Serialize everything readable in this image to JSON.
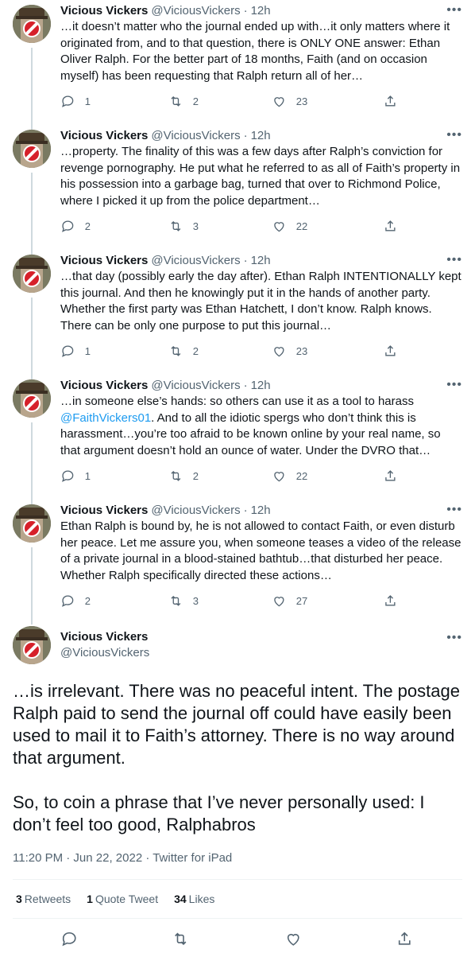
{
  "thread": [
    {
      "name": "Vicious Vickers",
      "handle": "@ViciousVickers",
      "dot": "·",
      "time": "12h",
      "text": "…it doesn’t matter who the journal ended up with…it only matters where it originated from, and to that question, there is ONLY ONE answer: Ethan Oliver Ralph. For the better part of 18 months, Faith (and on occasion myself) has been requesting that Ralph return all of her…",
      "replies": "1",
      "retweets": "2",
      "likes": "23"
    },
    {
      "name": "Vicious Vickers",
      "handle": "@ViciousVickers",
      "dot": "·",
      "time": "12h",
      "text": "…property. The finality of this was a few days after Ralph’s conviction for revenge pornography. He put what he referred to as all of Faith’s property in his possession into a garbage bag, turned that over to Richmond Police, where I picked it up from the police department…",
      "replies": "2",
      "retweets": "3",
      "likes": "22"
    },
    {
      "name": "Vicious Vickers",
      "handle": "@ViciousVickers",
      "dot": "·",
      "time": "12h",
      "text": "…that day (possibly early the day after). Ethan Ralph INTENTIONALLY kept this journal. And then he knowingly put it in the hands of another party. Whether the first party was Ethan Hatchett, I don’t know. Ralph knows. There can be only one purpose to put this journal…",
      "replies": "1",
      "retweets": "2",
      "likes": "23"
    },
    {
      "name": "Vicious Vickers",
      "handle": "@ViciousVickers",
      "dot": "·",
      "time": "12h",
      "text_before": "…in someone else’s hands: so others can use it as a tool to harass ",
      "mention": "@FaithVickers01",
      "text_after": ". And to all the idiotic spergs who don’t think this is harassment…you’re too afraid to be known online by your real name, so that argument doesn’t hold an ounce of water. Under the DVRO that…",
      "replies": "1",
      "retweets": "2",
      "likes": "22"
    },
    {
      "name": "Vicious Vickers",
      "handle": "@ViciousVickers",
      "dot": "·",
      "time": "12h",
      "text": "Ethan Ralph is bound by, he is not allowed to contact Faith, or even disturb her peace. Let me assure you, when someone teases a video of the release of a private journal in a blood-stained bathtub…that disturbed her peace. Whether Ralph specifically directed these actions…",
      "replies": "2",
      "retweets": "3",
      "likes": "27"
    }
  ],
  "main": {
    "name": "Vicious Vickers",
    "handle": "@ViciousVickers",
    "text": "…is irrelevant. There was no peaceful intent. The postage Ralph paid to send the journal off could have easily been used to mail it to Faith’s attorney. There is no way around that argument.\n\nSo, to coin a phrase that I’ve never personally used: I don’t feel too good, Ralphabros",
    "meta": "11:20 PM · Jun 22, 2022 · Twitter for iPad",
    "retweets_count": "3",
    "retweets_label": "Retweets",
    "quotes_count": "1",
    "quotes_label": "Quote Tweet",
    "likes_count": "34",
    "likes_label": "Likes"
  },
  "icons": {
    "more": "more-icon",
    "reply": "reply-icon",
    "retweet": "retweet-icon",
    "like": "like-icon",
    "share": "share-icon"
  },
  "colors": {
    "accent": "#1d9bf0",
    "text": "#0f1419",
    "secondary": "#536471",
    "line": "#cfd9de"
  }
}
